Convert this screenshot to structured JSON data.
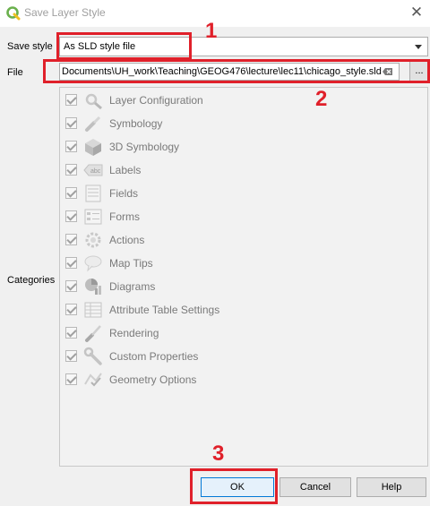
{
  "window": {
    "title": "Save Layer Style",
    "close_glyph": "✕"
  },
  "form": {
    "save_style_label": "Save style",
    "save_style_value": "As SLD style file",
    "file_label": "File",
    "file_value": "Documents\\UH_work\\Teaching\\GEOG476\\lecture\\lec11\\chicago_style.sld",
    "browse_label": "...",
    "categories_label": "Categories"
  },
  "categories": [
    {
      "label": "Layer Configuration",
      "icon": "gear-wrench-icon",
      "checked": true
    },
    {
      "label": "Symbology",
      "icon": "paintbrush-icon",
      "checked": true
    },
    {
      "label": "3D Symbology",
      "icon": "cube-icon",
      "checked": true
    },
    {
      "label": "Labels",
      "icon": "abc-label-icon",
      "checked": true
    },
    {
      "label": "Fields",
      "icon": "fields-table-icon",
      "checked": true
    },
    {
      "label": "Forms",
      "icon": "form-icon",
      "checked": true
    },
    {
      "label": "Actions",
      "icon": "actions-gear-icon",
      "checked": true
    },
    {
      "label": "Map Tips",
      "icon": "speech-bubble-icon",
      "checked": true
    },
    {
      "label": "Diagrams",
      "icon": "pie-diagram-icon",
      "checked": true
    },
    {
      "label": "Attribute Table Settings",
      "icon": "attribute-table-icon",
      "checked": true
    },
    {
      "label": "Rendering",
      "icon": "rendering-brush-icon",
      "checked": true
    },
    {
      "label": "Custom Properties",
      "icon": "wrench-icon",
      "checked": true
    },
    {
      "label": "Geometry Options",
      "icon": "geometry-check-icon",
      "checked": true
    }
  ],
  "buttons": {
    "ok": "OK",
    "cancel": "Cancel",
    "help": "Help"
  },
  "annotations": {
    "one": "1",
    "two": "2",
    "three": "3",
    "color": "#e0202a"
  }
}
